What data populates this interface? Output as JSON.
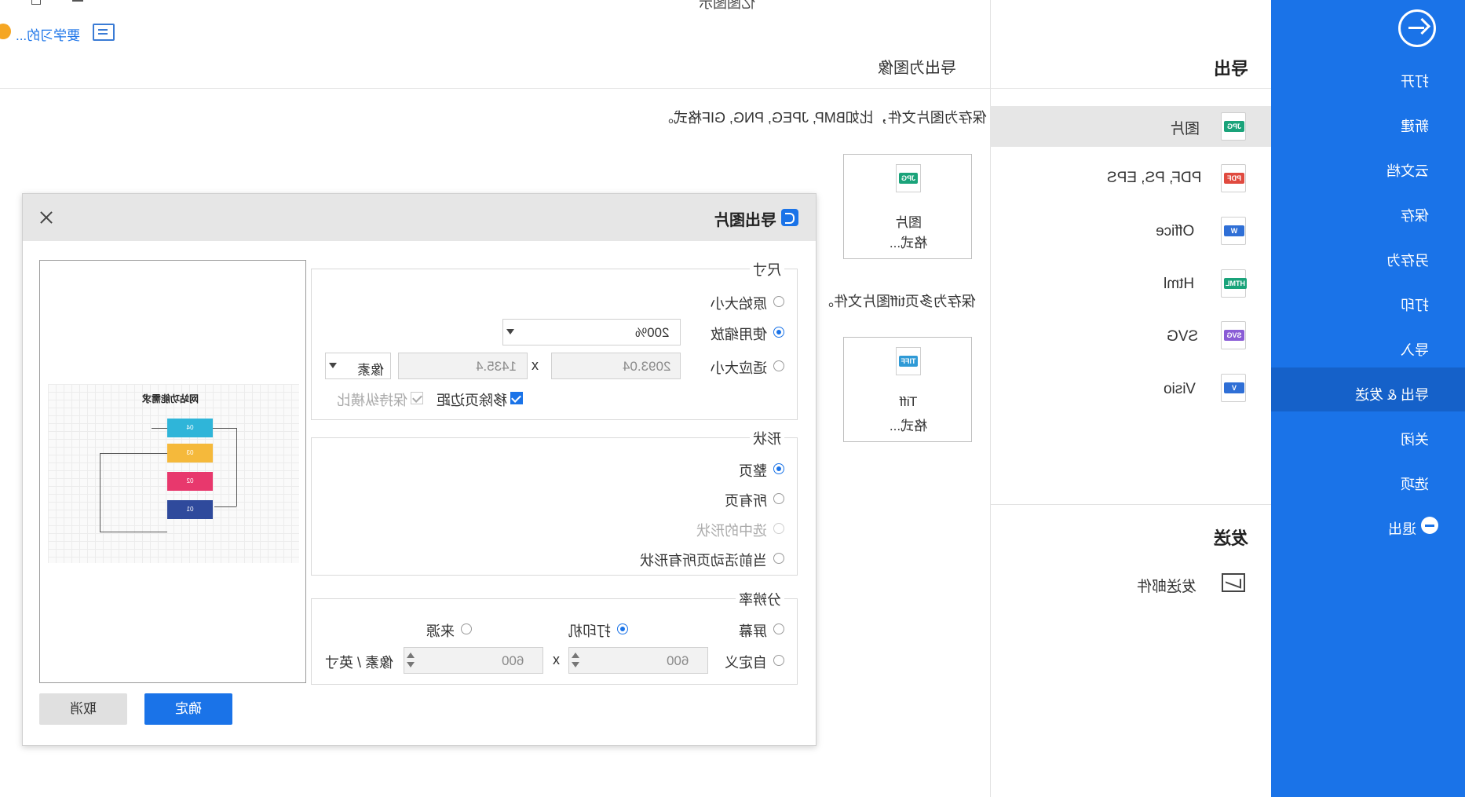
{
  "window": {
    "title": "亿图图示",
    "min_icon": "minimize-icon",
    "restore_icon": "restore-icon"
  },
  "topbar": {
    "notify_text": "要学习的...",
    "notify_icon": "chat-icon"
  },
  "sidebar": {
    "back_icon": "arrow-right-circle-icon",
    "items": [
      {
        "label": "打开"
      },
      {
        "label": "新建"
      },
      {
        "label": "云文档"
      },
      {
        "label": "保存"
      },
      {
        "label": "另存为"
      },
      {
        "label": "打印"
      },
      {
        "label": "导入"
      },
      {
        "label": "导出 & 发送"
      },
      {
        "label": "关闭"
      },
      {
        "label": "选项"
      },
      {
        "label": "退出"
      }
    ],
    "selected": "导出 & 发送",
    "accent": "#1a73e8"
  },
  "export_panel": {
    "export_heading": "导出",
    "formats": [
      {
        "label": "图片",
        "tag": "JPG",
        "color": "#1aa37a",
        "selected": true
      },
      {
        "label": "PDF, PS, EPS",
        "tag": "PDF",
        "color": "#e04a3f"
      },
      {
        "label": "Office",
        "tag": "W",
        "color": "#2f6fd6"
      },
      {
        "label": "Html",
        "tag": "HTML",
        "color": "#1aa37a"
      },
      {
        "label": "SVG",
        "tag": "SVG",
        "color": "#8a5cd6"
      },
      {
        "label": "Visio",
        "tag": "V",
        "color": "#2f6fd6"
      }
    ],
    "send_heading": "发送",
    "send_items": [
      {
        "label": "发送邮件",
        "icon": "mail-icon"
      }
    ]
  },
  "main": {
    "title": "导出为图像",
    "image_desc": "保存为图片文件，比如BMP, JPEG, PNG, GIF格式。",
    "tiff_desc": "保存为多页tiff图片文件。",
    "cards": [
      {
        "tag": "JPG",
        "color": "#1aa37a",
        "line1": "图片",
        "line2": "格式..."
      },
      {
        "tag": "TIFF",
        "color": "#2f9ad6",
        "line1": "Tiff",
        "line2": "格式..."
      }
    ]
  },
  "dialog": {
    "title": "导出图片",
    "title_icon": "edraw-logo-icon",
    "close_icon": "close-icon",
    "size_section": {
      "legend": "尺寸",
      "original": "原始大小",
      "zoom": "使用缩放",
      "zoom_value": "200%",
      "fit": "适应大小",
      "width": "2093.04",
      "x": "x",
      "height": "1435.4",
      "unit": "像素",
      "remove_margin": "移除页边距",
      "remove_margin_checked": true,
      "keep_ratio": "保持纵横比",
      "keep_ratio_checked": true,
      "selected": "zoom"
    },
    "shape_section": {
      "legend": "形状",
      "options": [
        "整页",
        "所有页",
        "选中的形状",
        "当前活动页所有形状"
      ],
      "selected": "整页",
      "disabled": [
        "选中的形状"
      ]
    },
    "resolution_section": {
      "legend": "分辨率",
      "screen": "屏幕",
      "printer": "打印机",
      "source": "来源",
      "selected": "printer",
      "custom": "自定义",
      "dpi_x": "600",
      "x": "x",
      "dpi_y": "600",
      "unit": "像素 / 英寸"
    },
    "preview": {
      "diagram_title": "网站功能需求",
      "boxes": [
        {
          "label": "04",
          "color": "#2fb5d9"
        },
        {
          "label": "03",
          "color": "#f5b93b"
        },
        {
          "label": "02",
          "color": "#e8386d"
        },
        {
          "label": "01",
          "color": "#2f4a9c"
        }
      ]
    },
    "ok": "确定",
    "cancel": "取消"
  }
}
